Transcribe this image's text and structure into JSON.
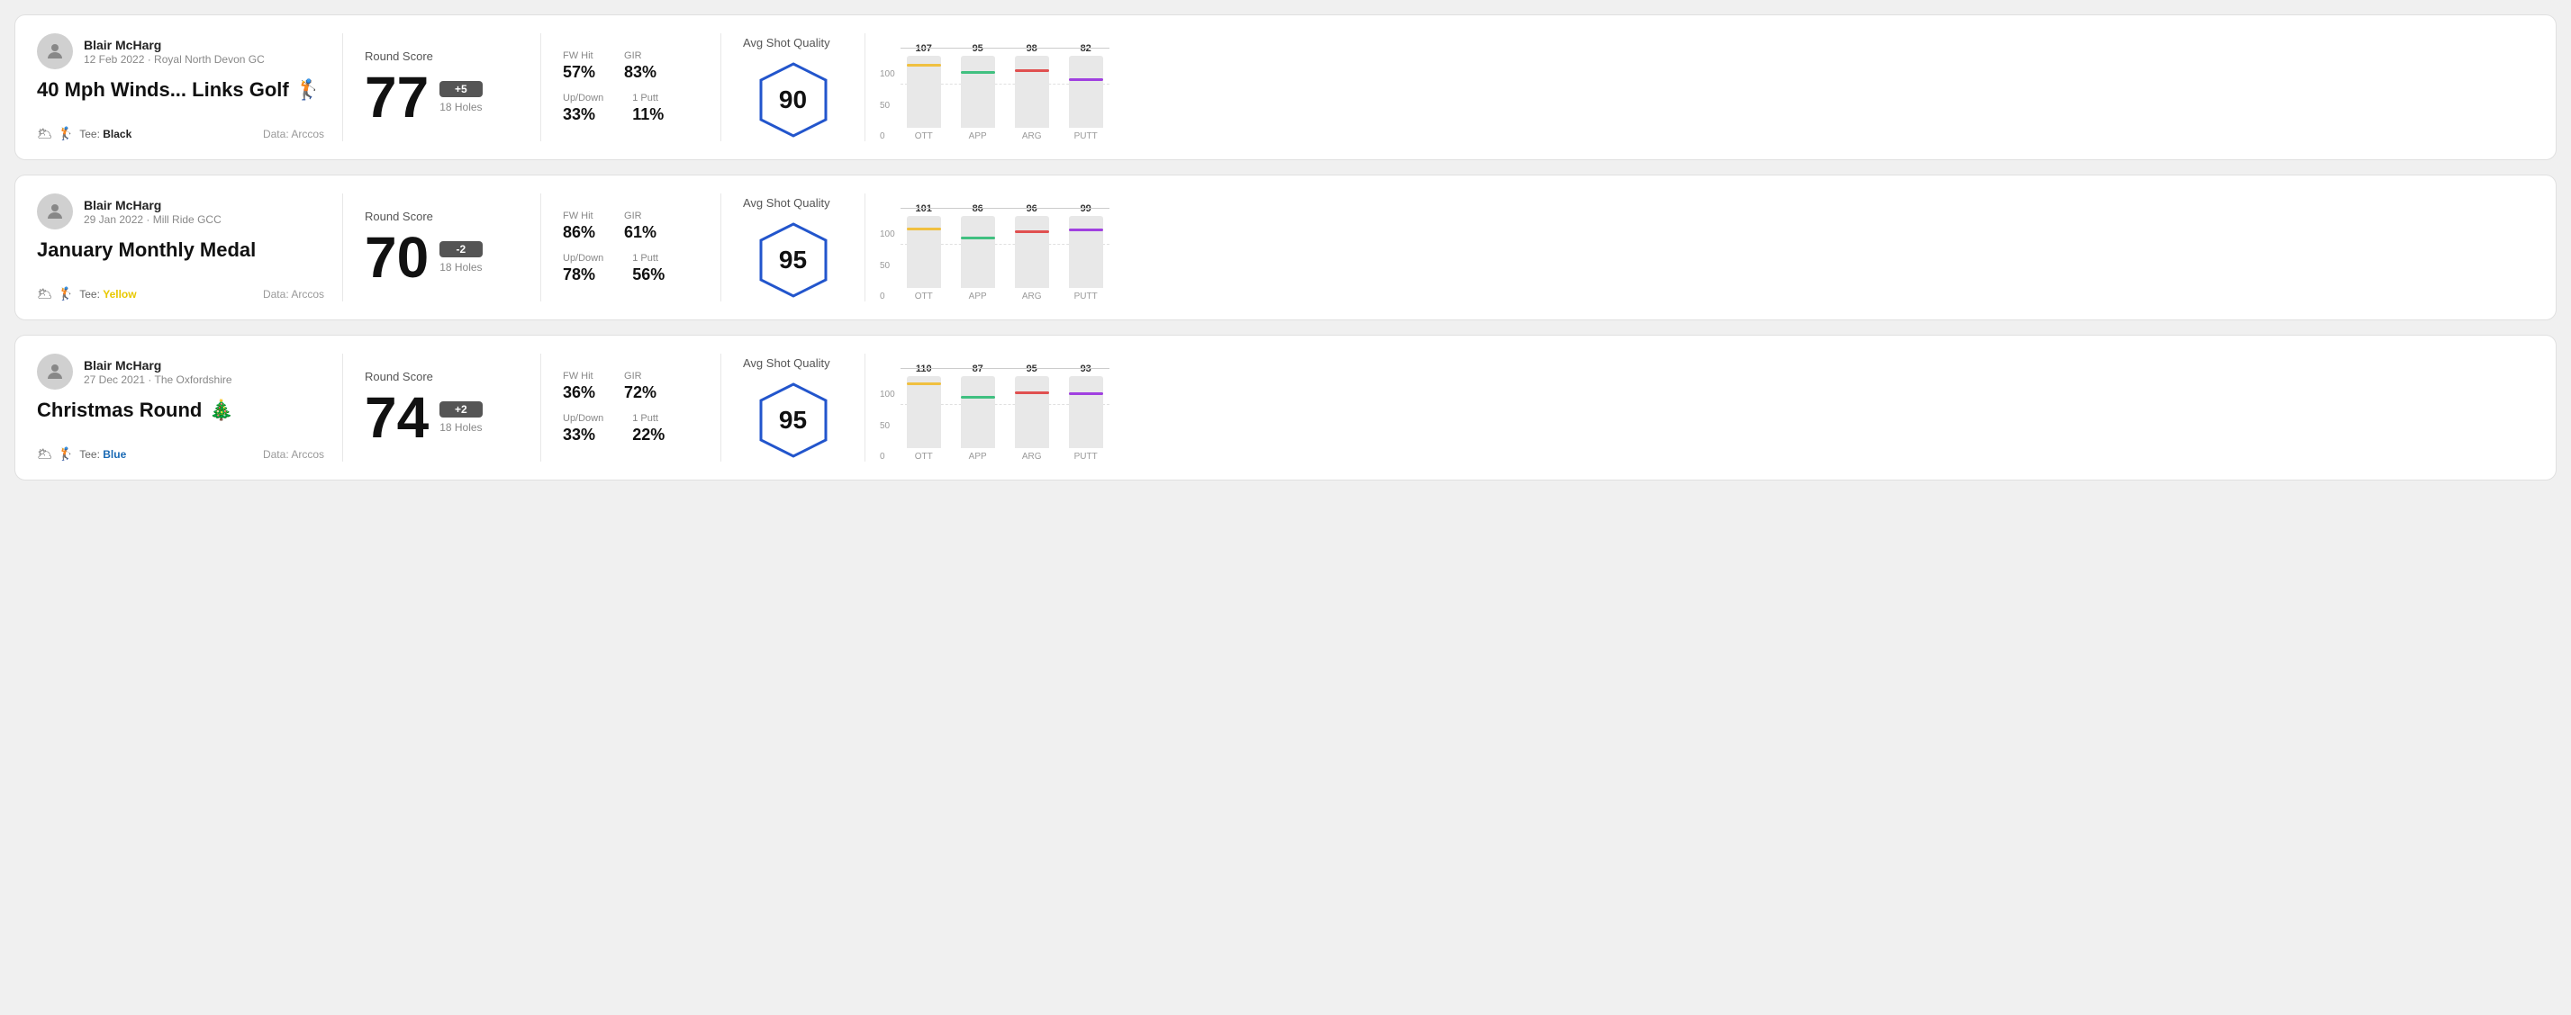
{
  "rounds": [
    {
      "id": "round1",
      "user": {
        "name": "Blair McHarg",
        "date": "12 Feb 2022 · Royal North Devon GC"
      },
      "title": "40 Mph Winds... Links Golf",
      "title_emoji": "🏌️",
      "tee": "Black",
      "data_source": "Data: Arccos",
      "score": {
        "label": "Round Score",
        "value": "77",
        "badge": "+5",
        "holes": "18 Holes"
      },
      "stats": {
        "fw_hit_label": "FW Hit",
        "fw_hit_value": "57%",
        "gir_label": "GIR",
        "gir_value": "83%",
        "updown_label": "Up/Down",
        "updown_value": "33%",
        "oneputt_label": "1 Putt",
        "oneputt_value": "11%"
      },
      "quality": {
        "label": "Avg Shot Quality",
        "score": "90"
      },
      "chart": {
        "bars": [
          {
            "label": "OTT",
            "value": 107,
            "color": "#f0c040"
          },
          {
            "label": "APP",
            "value": 95,
            "color": "#40c080"
          },
          {
            "label": "ARG",
            "value": 98,
            "color": "#e05050"
          },
          {
            "label": "PUTT",
            "value": 82,
            "color": "#a040e0"
          }
        ],
        "max": 120,
        "y_labels": [
          "100",
          "50",
          "0"
        ]
      }
    },
    {
      "id": "round2",
      "user": {
        "name": "Blair McHarg",
        "date": "29 Jan 2022 · Mill Ride GCC"
      },
      "title": "January Monthly Medal",
      "title_emoji": "",
      "tee": "Yellow",
      "data_source": "Data: Arccos",
      "score": {
        "label": "Round Score",
        "value": "70",
        "badge": "-2",
        "holes": "18 Holes"
      },
      "stats": {
        "fw_hit_label": "FW Hit",
        "fw_hit_value": "86%",
        "gir_label": "GIR",
        "gir_value": "61%",
        "updown_label": "Up/Down",
        "updown_value": "78%",
        "oneputt_label": "1 Putt",
        "oneputt_value": "56%"
      },
      "quality": {
        "label": "Avg Shot Quality",
        "score": "95"
      },
      "chart": {
        "bars": [
          {
            "label": "OTT",
            "value": 101,
            "color": "#f0c040"
          },
          {
            "label": "APP",
            "value": 86,
            "color": "#40c080"
          },
          {
            "label": "ARG",
            "value": 96,
            "color": "#e05050"
          },
          {
            "label": "PUTT",
            "value": 99,
            "color": "#a040e0"
          }
        ],
        "max": 120,
        "y_labels": [
          "100",
          "50",
          "0"
        ]
      }
    },
    {
      "id": "round3",
      "user": {
        "name": "Blair McHarg",
        "date": "27 Dec 2021 · The Oxfordshire"
      },
      "title": "Christmas Round",
      "title_emoji": "🎄",
      "tee": "Blue",
      "data_source": "Data: Arccos",
      "score": {
        "label": "Round Score",
        "value": "74",
        "badge": "+2",
        "holes": "18 Holes"
      },
      "stats": {
        "fw_hit_label": "FW Hit",
        "fw_hit_value": "36%",
        "gir_label": "GIR",
        "gir_value": "72%",
        "updown_label": "Up/Down",
        "updown_value": "33%",
        "oneputt_label": "1 Putt",
        "oneputt_value": "22%"
      },
      "quality": {
        "label": "Avg Shot Quality",
        "score": "95"
      },
      "chart": {
        "bars": [
          {
            "label": "OTT",
            "value": 110,
            "color": "#f0c040"
          },
          {
            "label": "APP",
            "value": 87,
            "color": "#40c080"
          },
          {
            "label": "ARG",
            "value": 95,
            "color": "#e05050"
          },
          {
            "label": "PUTT",
            "value": 93,
            "color": "#a040e0"
          }
        ],
        "max": 120,
        "y_labels": [
          "100",
          "50",
          "0"
        ]
      }
    }
  ]
}
